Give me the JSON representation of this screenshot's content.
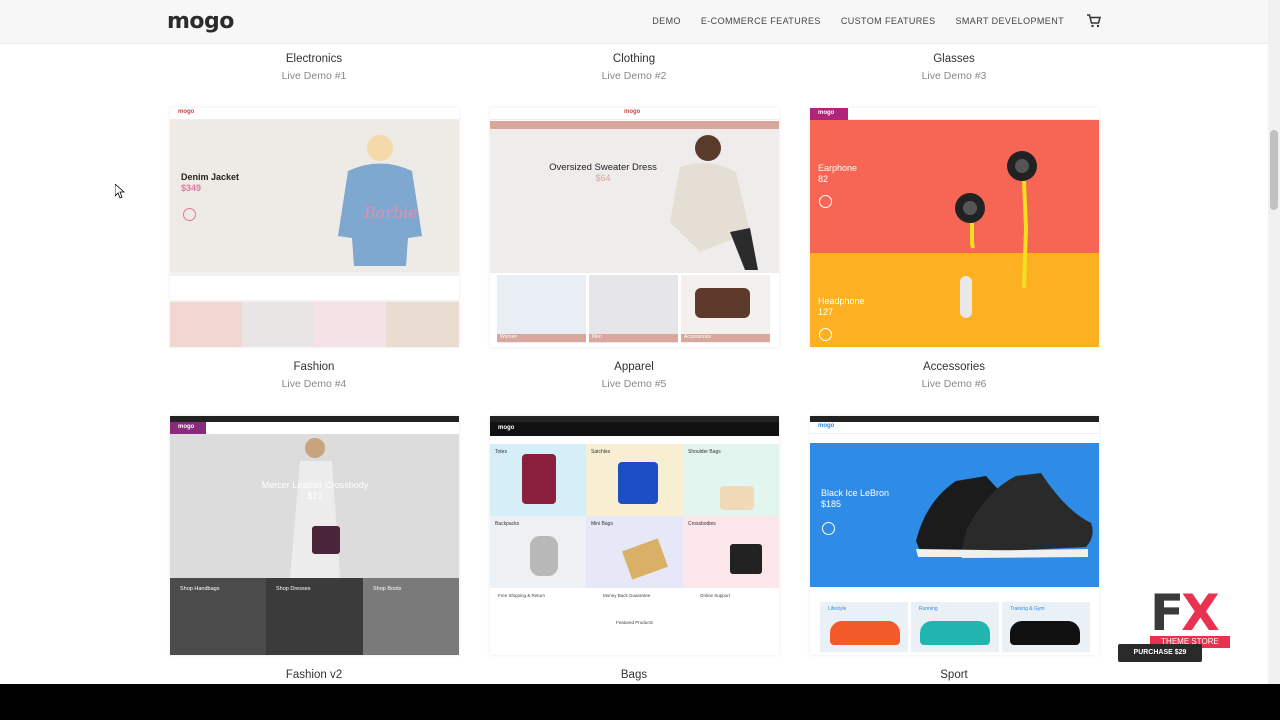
{
  "header": {
    "logo": "mogo",
    "nav": [
      "DEMO",
      "E-COMMERCE FEATURES",
      "CUSTOM FEATURES",
      "SMART DEVELOPMENT"
    ]
  },
  "demos_row1": [
    {
      "title": "Electronics",
      "subtitle": "Live Demo #1"
    },
    {
      "title": "Clothing",
      "subtitle": "Live Demo #2"
    },
    {
      "title": "Glasses",
      "subtitle": "Live Demo #3"
    }
  ],
  "demos_row2": [
    {
      "title": "Fashion",
      "subtitle": "Live Demo #4",
      "hero_title": "Denim Jacket",
      "hero_price": "$349"
    },
    {
      "title": "Apparel",
      "subtitle": "Live Demo #5",
      "hero_title": "Oversized Sweater Dress",
      "hero_price": "$64",
      "tiles": [
        "Women",
        "Men",
        "Accessories"
      ]
    },
    {
      "title": "Accessories",
      "subtitle": "Live Demo #6",
      "hero_title": "Earphone",
      "hero_price": "82",
      "hero2_title": "Headphone",
      "hero2_price": "127"
    }
  ],
  "demos_row3": [
    {
      "title": "Fashion v2",
      "hero_title": "Mercer Leather Crossbody",
      "hero_price": "$73",
      "tiles": [
        "Shop Handbags",
        "Shop Dresses",
        "Shop Boots"
      ]
    },
    {
      "title": "Bags",
      "tiles": [
        "Totes",
        "Satchles",
        "Shoulder Bags",
        "Backpacks",
        "Mini Bags",
        "Crossbodies"
      ],
      "features": [
        "Free Shipping & Return",
        "Money Back Guarantee",
        "Online Support"
      ],
      "featured": "Featured Products"
    },
    {
      "title": "Sport",
      "hero_title": "Black Ice LeBron",
      "hero_price": "$185",
      "tiles": [
        "Lifestyle",
        "Running",
        "Training & Gym"
      ]
    }
  ],
  "badge": {
    "brand": "FX",
    "store": "THEME STORE",
    "purchase": "PURCHASE $29"
  },
  "colors": {
    "pink_accent": "#e07aa0",
    "earphone_bg": "#f76555",
    "headphone_bg": "#fdb022",
    "sport_bg": "#2e8be6"
  }
}
